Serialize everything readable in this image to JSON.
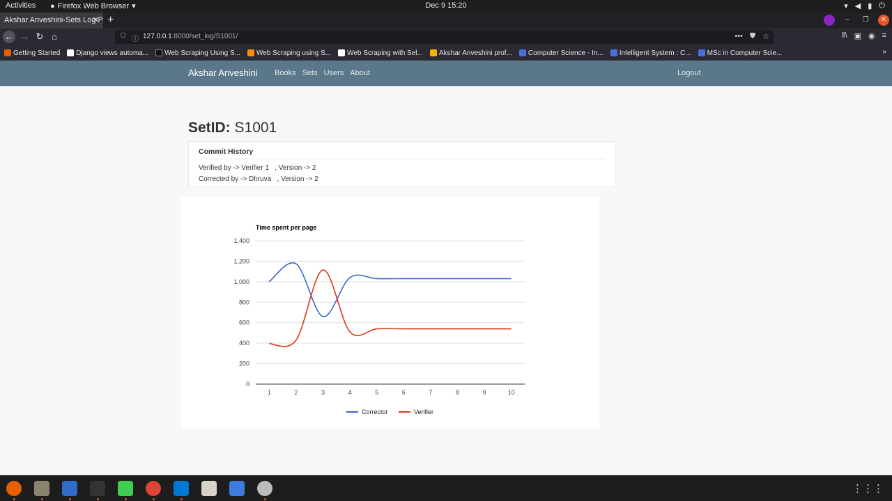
{
  "system": {
    "activities": "Activities",
    "app_menu": "Firefox Web Browser",
    "clock": "Dec 9  15:20"
  },
  "browser": {
    "tab_title": "Akshar Anveshini-Sets Log P",
    "url_host": "127.0.0.1",
    "url_rest": ":8000/set_log/S1001/",
    "bookmarks": [
      {
        "label": "Getting Started",
        "color": "#e66000"
      },
      {
        "label": "Django views automa...",
        "color": "#ffffff"
      },
      {
        "label": "Web Scraping Using S...",
        "color": "#111111"
      },
      {
        "label": "Web Scraping using S...",
        "color": "#ff8a00"
      },
      {
        "label": "Web Scraping with Sel...",
        "color": "#ffffff"
      },
      {
        "label": "Akshar Anveshini prof...",
        "color": "#f4b400"
      },
      {
        "label": "Computer Science - In...",
        "color": "#4a6ee0"
      },
      {
        "label": "Intelligent System : C...",
        "color": "#4a6ee0"
      },
      {
        "label": "MSc in Computer Scie...",
        "color": "#4a6ee0"
      }
    ]
  },
  "site": {
    "brand": "Akshar Anveshini",
    "nav": [
      "Books",
      "Sets",
      "Users",
      "About"
    ],
    "logout": "Logout"
  },
  "page": {
    "setid_label": "SetID:",
    "setid_value": "S1001",
    "commit_title": "Commit History",
    "commits": [
      "Verified by -> Verifier 1   , Version -> 2",
      "Corrected by -> Dhruva   , Version -> 2"
    ]
  },
  "chart_data": {
    "type": "line",
    "title": "Time spent per page",
    "x": [
      1,
      2,
      3,
      4,
      5,
      6,
      7,
      8,
      9,
      10
    ],
    "ylim": [
      0,
      1400
    ],
    "yticks": [
      0,
      200,
      400,
      600,
      800,
      1000,
      1200,
      1400
    ],
    "ytick_labels": [
      "0",
      "200",
      "400",
      "600",
      "800",
      "1,000",
      "1,200",
      "1,400"
    ],
    "grid": true,
    "legend": "bottom",
    "series": [
      {
        "name": "Corrector",
        "color": "#3366cc",
        "values": [
          1000,
          1175,
          660,
          1040,
          1030,
          1030,
          1030,
          1030,
          1030,
          1030
        ]
      },
      {
        "name": "Verifier",
        "color": "#dc3912",
        "values": [
          395,
          430,
          1115,
          510,
          540,
          540,
          540,
          540,
          540,
          540
        ]
      }
    ]
  }
}
